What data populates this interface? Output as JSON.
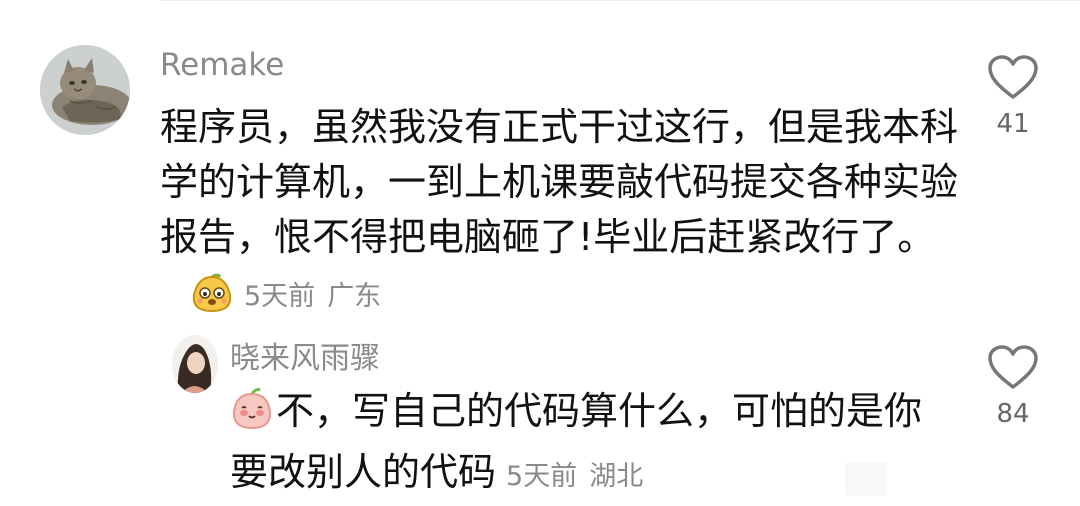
{
  "comment": {
    "username": "Remake",
    "text": "程序员，虽然我没有正式干过这行，但是我本科学的计算机，一到上机课要敲代码提交各种实验报告，恨不得把电脑砸了!毕业后赶紧改行了。",
    "emoji": "smiling-pear-emoji",
    "time": "5天前",
    "region": "广东",
    "likes": "41",
    "like_icon": "heart-outline-icon"
  },
  "reply": {
    "username": "晓来风雨骤",
    "emoji": "blushing-peach-emoji",
    "text": "不，写自己的代码算什么，可怕的是你要改别人的代码",
    "time": "5天前",
    "region": "湖北",
    "likes": "84",
    "like_icon": "heart-outline-icon"
  },
  "colors": {
    "username": "#8a8a8a",
    "text": "#111111",
    "meta": "#8a8a8a",
    "likes": "#666666",
    "heart": "#777777"
  }
}
